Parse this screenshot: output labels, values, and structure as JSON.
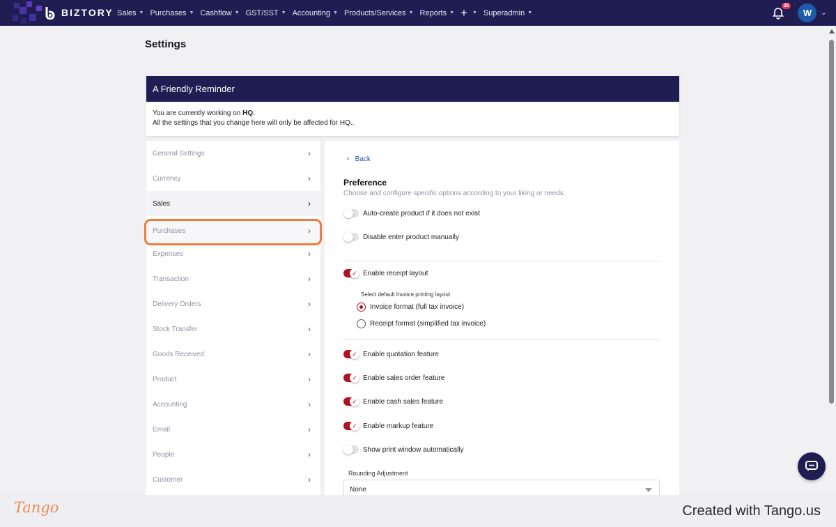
{
  "brand": {
    "name": "BIZTORY"
  },
  "nav": {
    "items": [
      "Sales",
      "Purchases",
      "Cashflow",
      "GST/SST",
      "Accounting",
      "Products/Services",
      "Reports"
    ],
    "plus": "+",
    "admin": "Superadmin",
    "notification_count": "35",
    "avatar_initial": "W"
  },
  "page": {
    "title": "Settings"
  },
  "reminder": {
    "heading": "A Friendly Reminder",
    "line1_prefix": "You are currently working on ",
    "line1_entity": "HQ",
    "line1_suffix": ".",
    "line2": "All the settings that you change here will only be affected for HQ.."
  },
  "sidebar": {
    "items": [
      {
        "label": "General Settings"
      },
      {
        "label": "Currency"
      },
      {
        "label": "Sales",
        "active": true
      },
      {
        "label": "Purchases",
        "highlighted": true
      },
      {
        "label": "Expenses"
      },
      {
        "label": "Transaction"
      },
      {
        "label": "Delivery Orders"
      },
      {
        "label": "Stock Transfer"
      },
      {
        "label": "Goods Received"
      },
      {
        "label": "Product"
      },
      {
        "label": "Accounting"
      },
      {
        "label": "Email"
      },
      {
        "label": "People"
      },
      {
        "label": "Customer"
      }
    ]
  },
  "content": {
    "back_label": "Back",
    "title": "Preference",
    "description": "Choose and configure specific options according to your liking or needs.",
    "toggles": {
      "auto_create": {
        "label": "Auto-create product if it does not exist",
        "on": false
      },
      "disable_manual": {
        "label": "Disable enter product manually",
        "on": false
      },
      "receipt_layout": {
        "label": "Enable receipt layout",
        "on": true
      },
      "quotation": {
        "label": "Enable quotation feature",
        "on": true
      },
      "sales_order": {
        "label": "Enable sales order feature",
        "on": true
      },
      "cash_sales": {
        "label": "Enable cash sales feature",
        "on": true
      },
      "markup": {
        "label": "Enable markup feature",
        "on": true
      },
      "print_window": {
        "label": "Show print window automatically",
        "on": false
      }
    },
    "print_layout_label": "Select default Invoice printing layout",
    "radios": {
      "invoice": {
        "label": "Invoice format (full tax invoice)",
        "checked": true
      },
      "receipt": {
        "label": "Receipt format (simplified tax invoice)",
        "checked": false
      }
    },
    "rounding": {
      "label": "Rounding Adjustment",
      "value": "None"
    }
  },
  "footer": {
    "logo_text": "Tango",
    "created_text": "Created with Tango.us"
  },
  "colors": {
    "nav_bg": "#1f1d52",
    "toggle_on": "#b3111f",
    "highlight": "#f07b3b",
    "link": "#1c5cab"
  }
}
